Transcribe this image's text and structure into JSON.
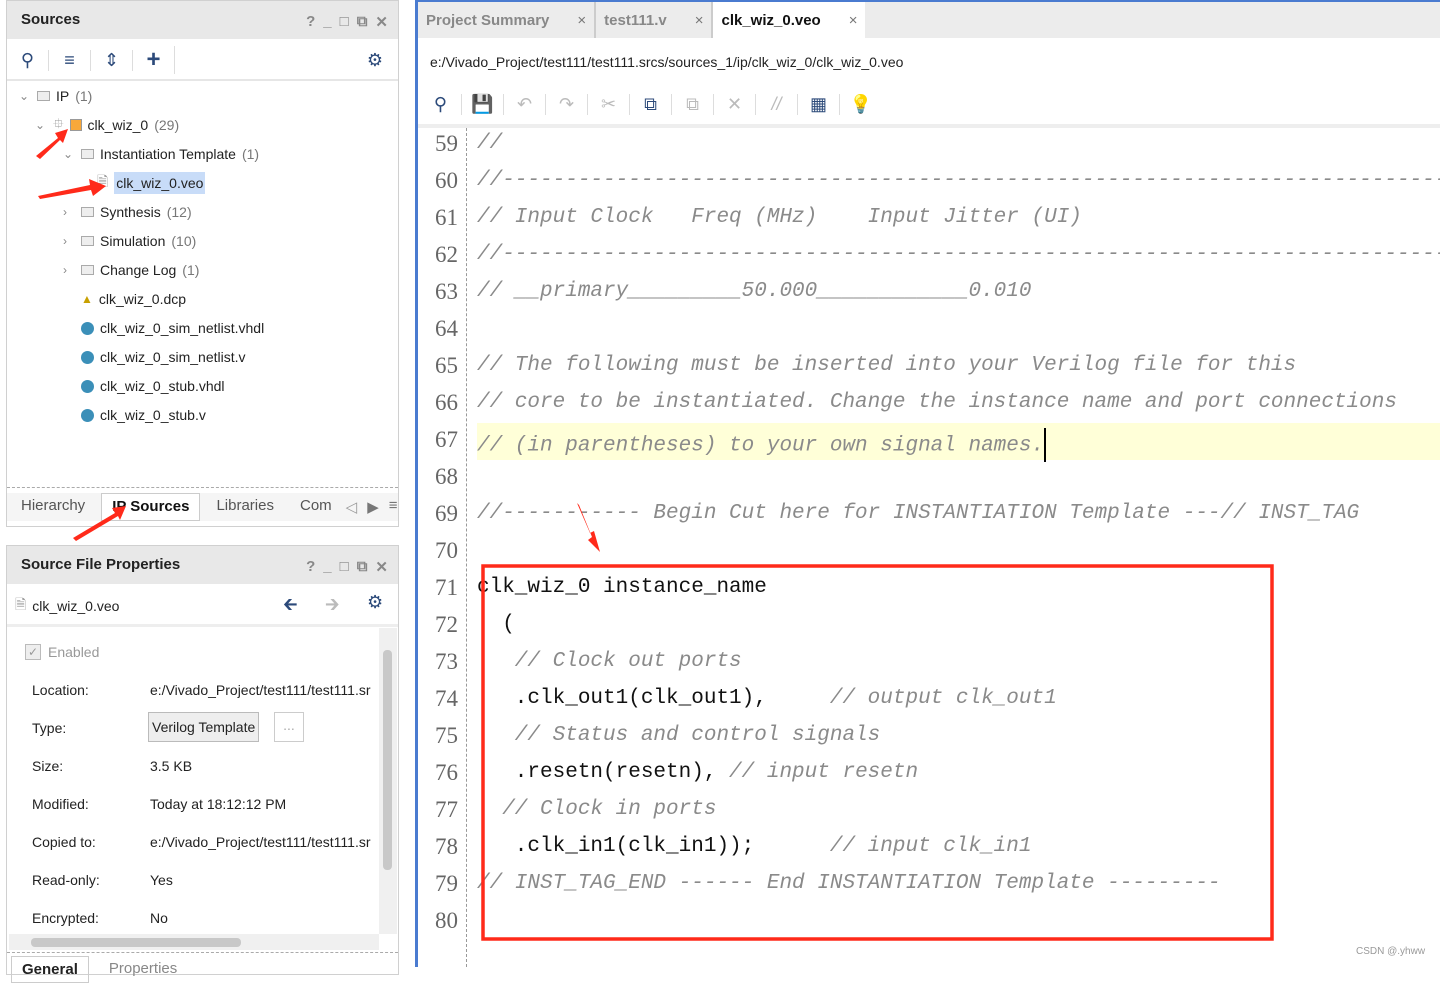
{
  "sources_panel": {
    "title": "Sources",
    "window_controls": [
      "?",
      "_",
      "□",
      "⧉",
      "✕"
    ],
    "tree": [
      {
        "label": "IP",
        "count": "(1)",
        "indent": 0,
        "icon": "folder-icon",
        "expand": "open"
      },
      {
        "label": "clk_wiz_0",
        "count": "(29)",
        "indent": 1,
        "icon": "ip-core-icon",
        "expand": "open"
      },
      {
        "label": "Instantiation Template",
        "count": "(1)",
        "indent": 2,
        "icon": "folder-icon",
        "expand": "open"
      },
      {
        "label": "clk_wiz_0.veo",
        "count": "",
        "indent": 3,
        "icon": "file-icon",
        "expand": "none",
        "selected": true
      },
      {
        "label": "Synthesis",
        "count": "(12)",
        "indent": 2,
        "icon": "folder-icon",
        "expand": "closed"
      },
      {
        "label": "Simulation",
        "count": "(10)",
        "indent": 2,
        "icon": "folder-icon",
        "expand": "closed"
      },
      {
        "label": "Change Log",
        "count": "(1)",
        "indent": 2,
        "icon": "folder-icon",
        "expand": "closed"
      },
      {
        "label": "clk_wiz_0.dcp",
        "count": "",
        "indent": 2,
        "icon": "checkpoint-icon",
        "expand": "none"
      },
      {
        "label": "clk_wiz_0_sim_netlist.vhdl",
        "count": "",
        "indent": 2,
        "icon": "dot-icon",
        "expand": "none"
      },
      {
        "label": "clk_wiz_0_sim_netlist.v",
        "count": "",
        "indent": 2,
        "icon": "dot-icon",
        "expand": "none"
      },
      {
        "label": "clk_wiz_0_stub.vhdl",
        "count": "",
        "indent": 2,
        "icon": "dot-icon",
        "expand": "none"
      },
      {
        "label": "clk_wiz_0_stub.v",
        "count": "",
        "indent": 2,
        "icon": "dot-icon",
        "expand": "none"
      }
    ],
    "tabs": [
      "Hierarchy",
      "IP Sources",
      "Libraries",
      "Com"
    ],
    "active_tab": "IP Sources"
  },
  "properties_panel": {
    "title": "Source File Properties",
    "file": "clk_wiz_0.veo",
    "enabled_label": "Enabled",
    "rows": [
      {
        "label": "Location:",
        "value": "e:/Vivado_Project/test111/test111.sr"
      },
      {
        "label": "Type:",
        "value": "Verilog Template"
      },
      {
        "label": "Size:",
        "value": "3.5 KB"
      },
      {
        "label": "Modified:",
        "value": "Today at 18:12:12 PM"
      },
      {
        "label": "Copied to:",
        "value": "e:/Vivado_Project/test111/test111.sr"
      },
      {
        "label": "Read-only:",
        "value": "Yes"
      },
      {
        "label": "Encrypted:",
        "value": "No"
      }
    ],
    "type_more": "...",
    "bottom_tabs": [
      "General",
      "Properties"
    ]
  },
  "editor": {
    "tabs": [
      {
        "label": "Project Summary"
      },
      {
        "label": "test111.v"
      },
      {
        "label": "clk_wiz_0.veo",
        "active": true
      }
    ],
    "close": "×",
    "path": "e:/Vivado_Project/test111/test111.srcs/sources_1/ip/clk_wiz_0/clk_wiz_0.veo",
    "lines": [
      {
        "n": "59",
        "parts": [
          {
            "t": "//",
            "c": "cm"
          }
        ]
      },
      {
        "n": "60",
        "parts": [
          {
            "t": "//----------------------------------------------------------------------------",
            "c": "cm"
          }
        ]
      },
      {
        "n": "61",
        "parts": [
          {
            "t": "// Input Clock   Freq (MHz)    Input Jitter (UI)",
            "c": "cm"
          }
        ]
      },
      {
        "n": "62",
        "parts": [
          {
            "t": "//----------------------------------------------------------------------------",
            "c": "cm"
          }
        ]
      },
      {
        "n": "63",
        "parts": [
          {
            "t": "// __primary_________50.000____________0.010",
            "c": "cm"
          }
        ]
      },
      {
        "n": "64",
        "parts": []
      },
      {
        "n": "65",
        "parts": [
          {
            "t": "// The following must be inserted into your Verilog file for this",
            "c": "cm"
          }
        ]
      },
      {
        "n": "66",
        "parts": [
          {
            "t": "// core to be instantiated. Change the instance name and port connections",
            "c": "cm"
          }
        ]
      },
      {
        "n": "67",
        "parts": [
          {
            "t": "// (in parentheses) to your own signal names.",
            "c": "cm"
          }
        ],
        "current": true
      },
      {
        "n": "68",
        "parts": []
      },
      {
        "n": "69",
        "parts": [
          {
            "t": "//----------- Begin Cut here for INSTANTIATION Template ---// INST_TAG",
            "c": "cm"
          }
        ]
      },
      {
        "n": "70",
        "parts": []
      },
      {
        "n": "71",
        "parts": [
          {
            "t": "clk_wiz_0 instance_name",
            "c": "k"
          }
        ]
      },
      {
        "n": "72",
        "parts": [
          {
            "t": "  (",
            "c": "k"
          }
        ]
      },
      {
        "n": "73",
        "parts": [
          {
            "t": "   // Clock out ports",
            "c": "cm"
          }
        ]
      },
      {
        "n": "74",
        "parts": [
          {
            "t": "   .clk_out1(clk_out1),     ",
            "c": "k"
          },
          {
            "t": "// output clk_out1",
            "c": "cm"
          }
        ]
      },
      {
        "n": "75",
        "parts": [
          {
            "t": "   // Status and control signals",
            "c": "cm"
          }
        ]
      },
      {
        "n": "76",
        "parts": [
          {
            "t": "   .resetn(resetn), ",
            "c": "k"
          },
          {
            "t": "// input resetn",
            "c": "cm"
          }
        ]
      },
      {
        "n": "77",
        "parts": [
          {
            "t": "  // Clock in ports",
            "c": "cm"
          }
        ]
      },
      {
        "n": "78",
        "parts": [
          {
            "t": "   .clk_in1(clk_in1));      ",
            "c": "k"
          },
          {
            "t": "// input clk_in1",
            "c": "cm"
          }
        ]
      },
      {
        "n": "79",
        "parts": [
          {
            "t": "// INST_TAG_END ------ End INSTANTIATION Template ---------",
            "c": "cm"
          }
        ]
      },
      {
        "n": "80",
        "parts": []
      }
    ]
  },
  "watermark": "CSDN @.yhww",
  "colors": {
    "accent": "#2c4a7a",
    "highlight": "#c8dcf8",
    "annotation": "#ff2a1a",
    "current_line": "#ffffd8",
    "editor_border": "#4a7bd0"
  }
}
